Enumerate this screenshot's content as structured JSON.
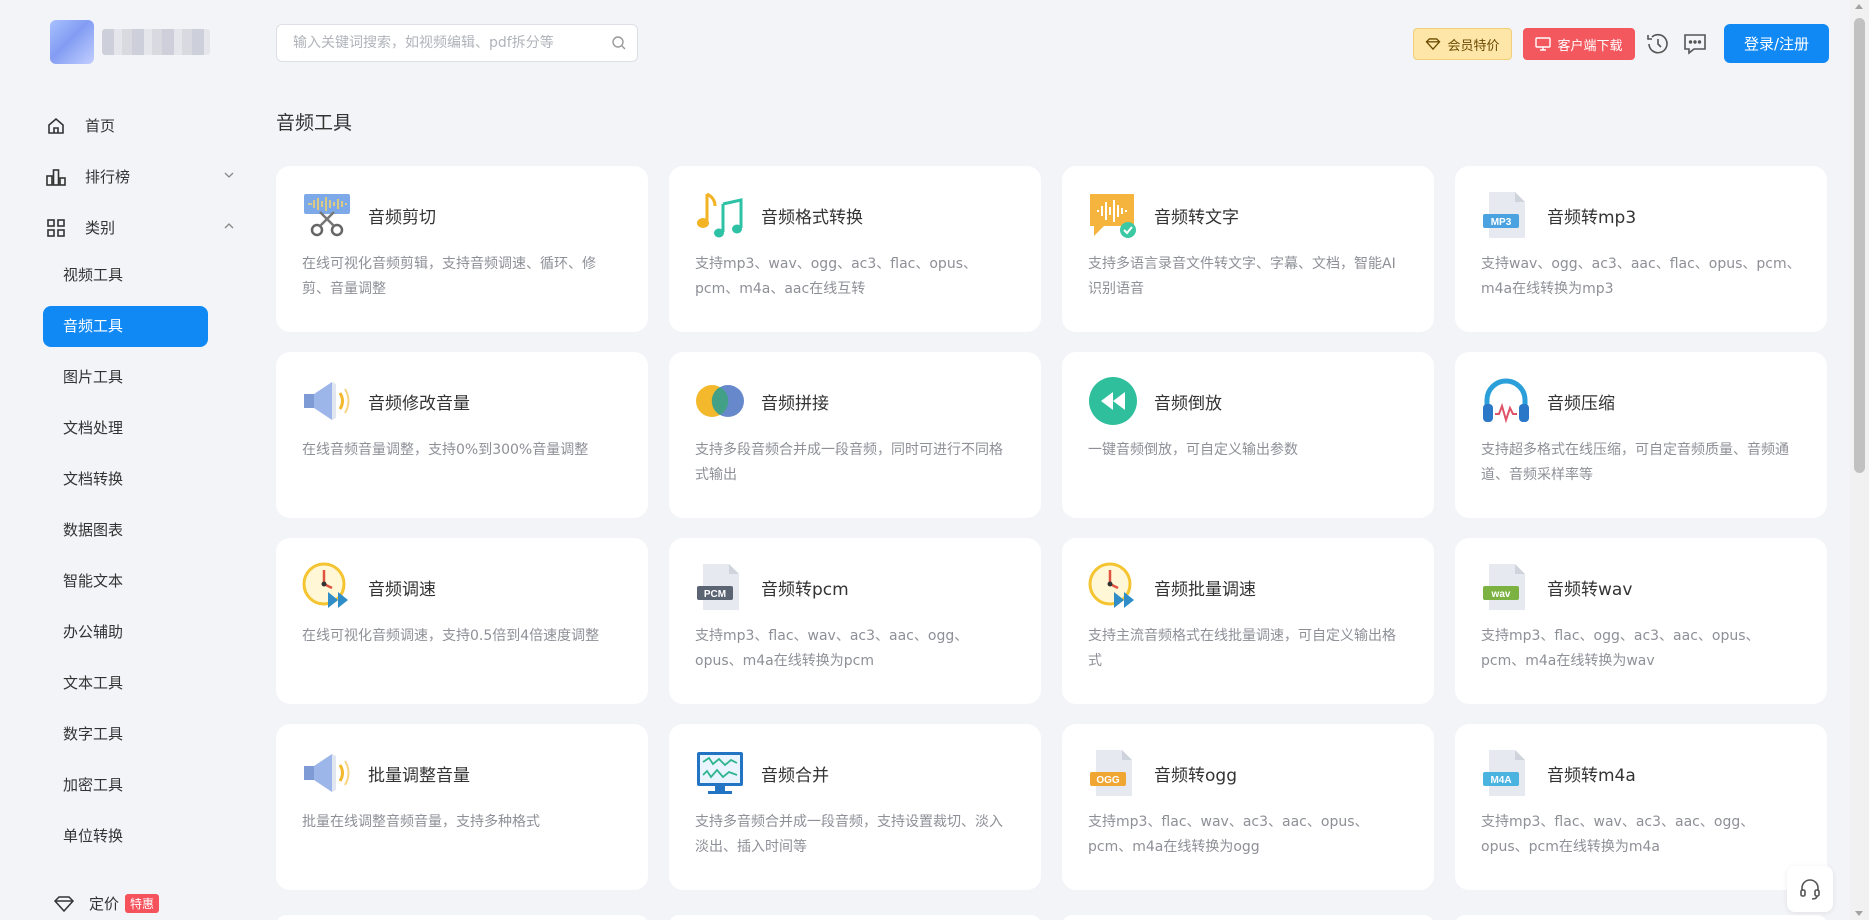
{
  "sidebar": {
    "main_items": [
      {
        "label": "首页",
        "icon": "home-icon"
      },
      {
        "label": "排行榜",
        "icon": "bar-chart-icon"
      },
      {
        "label": "类别",
        "icon": "grid-icon"
      }
    ],
    "sub_items": [
      {
        "label": "视频工具",
        "active": false
      },
      {
        "label": "音频工具",
        "active": true
      },
      {
        "label": "图片工具",
        "active": false
      },
      {
        "label": "文档处理",
        "active": false
      },
      {
        "label": "文档转换",
        "active": false
      },
      {
        "label": "数据图表",
        "active": false
      },
      {
        "label": "智能文本",
        "active": false
      },
      {
        "label": "办公辅助",
        "active": false
      },
      {
        "label": "文本工具",
        "active": false
      },
      {
        "label": "数字工具",
        "active": false
      },
      {
        "label": "加密工具",
        "active": false
      },
      {
        "label": "单位转换",
        "active": false
      }
    ],
    "pricing": {
      "label": "定价",
      "badge": "特惠"
    }
  },
  "header": {
    "search_placeholder": "输入关键词搜索，如视频编辑、pdf拆分等",
    "vip_label": "会员特价",
    "download_label": "客户端下载",
    "login_label": "登录/注册"
  },
  "page_title": "音频工具",
  "tools": [
    {
      "name": "音频剪切",
      "desc": "在线可视化音频剪辑，支持音频调速、循环、修剪、音量调整",
      "icon": "scissors-icon"
    },
    {
      "name": "音频格式转换",
      "desc": "支持mp3、wav、ogg、ac3、flac、opus、pcm、m4a、aac在线互转",
      "icon": "music-notes-icon"
    },
    {
      "name": "音频转文字",
      "desc": "支持多语言录音文件转文字、字幕、文档，智能AI识别语音",
      "icon": "speech-wave-icon"
    },
    {
      "name": "音频转mp3",
      "desc": "支持wav、ogg、ac3、aac、flac、opus、pcm、m4a在线转换为mp3",
      "icon": "mp3-file-icon",
      "file_label": "MP3",
      "file_color": "#4aa3e0"
    },
    {
      "name": "音频修改音量",
      "desc": "在线音频音量调整，支持0%到300%音量调整",
      "icon": "speaker-icon"
    },
    {
      "name": "音频拼接",
      "desc": "支持多段音频合并成一段音频，同时可进行不同格式输出",
      "icon": "merge-circles-icon"
    },
    {
      "name": "音频倒放",
      "desc": "一键音频倒放，可自定义输出参数",
      "icon": "rewind-icon"
    },
    {
      "name": "音频压缩",
      "desc": "支持超多格式在线压缩，可自定音频质量、音频通道、音频采样率等",
      "icon": "headphones-icon"
    },
    {
      "name": "音频调速",
      "desc": "在线可视化音频调速，支持0.5倍到4倍速度调整",
      "icon": "speed-clock-icon"
    },
    {
      "name": "音频转pcm",
      "desc": "支持mp3、flac、wav、ac3、aac、ogg、opus、m4a在线转换为pcm",
      "icon": "pcm-file-icon",
      "file_label": "PCM",
      "file_color": "#5b6473"
    },
    {
      "name": "音频批量调速",
      "desc": "支持主流音频格式在线批量调速，可自定义输出格式",
      "icon": "speed-clock-icon"
    },
    {
      "name": "音频转wav",
      "desc": "支持mp3、flac、ogg、ac3、aac、opus、pcm、m4a在线转换为wav",
      "icon": "wav-file-icon",
      "file_label": "wav",
      "file_color": "#7bb241"
    },
    {
      "name": "批量调整音量",
      "desc": "批量在线调整音频音量，支持多种格式",
      "icon": "speaker-icon"
    },
    {
      "name": "音频合并",
      "desc": "支持多音频合并成一段音频，支持设置裁切、淡入淡出、插入时间等",
      "icon": "monitor-wave-icon"
    },
    {
      "name": "音频转ogg",
      "desc": "支持mp3、flac、wav、ac3、aac、opus、pcm、m4a在线转换为ogg",
      "icon": "ogg-file-icon",
      "file_label": "OGG",
      "file_color": "#f0a632"
    },
    {
      "name": "音频转m4a",
      "desc": "支持mp3、flac、wav、ac3、aac、ogg、opus、pcm在线转换为m4a",
      "icon": "m4a-file-icon",
      "file_label": "M4A",
      "file_color": "#4ab3e0"
    }
  ],
  "colors": {
    "primary": "#1089f5",
    "download": "#f4585f",
    "vip": "#fde6a7",
    "badge": "#f5525b"
  }
}
